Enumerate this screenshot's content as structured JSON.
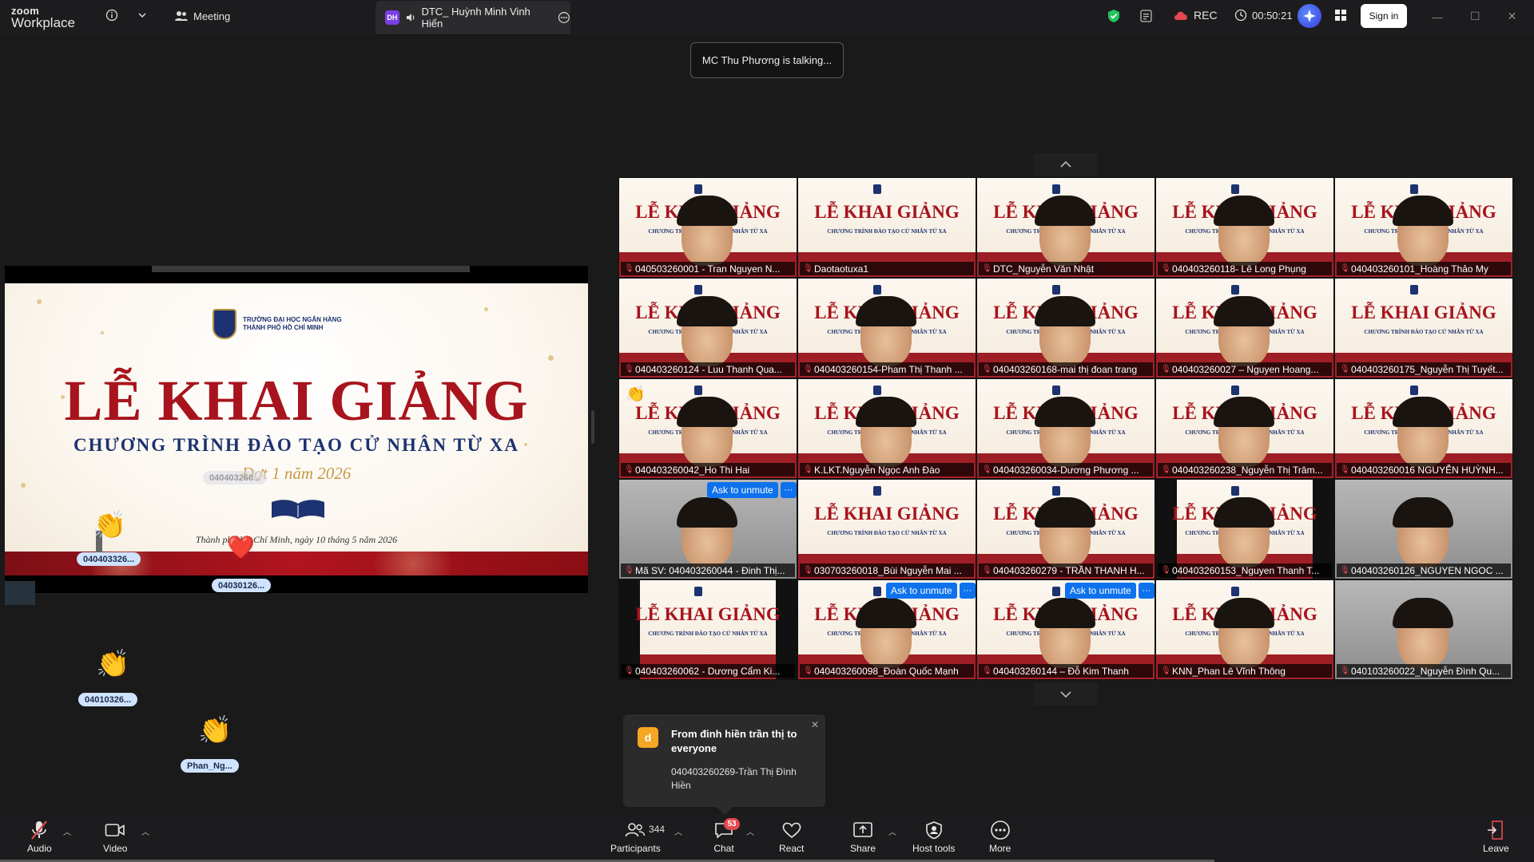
{
  "app": {
    "logo_line1": "zoom",
    "logo_line2": "Workplace"
  },
  "topbar": {
    "meeting_label": "Meeting",
    "share_tab_badge": "DH",
    "share_tab_label": "DTC_ Huỳnh Minh Vinh Hiển",
    "rec_label": "REC",
    "timer": "00:50:21",
    "sign_in_label": "Sign in"
  },
  "talking_banner": "MC Thu Phương is talking...",
  "slide": {
    "school_line1": "TRƯỜNG ĐẠI HỌC NGÂN HÀNG",
    "school_line2": "THÀNH PHỐ HỒ CHÍ MINH",
    "title": "LỄ KHAI GIẢNG",
    "subtitle": "CHƯƠNG TRÌNH ĐÀO TẠO CỬ NHÂN TỪ XA",
    "batch": "Đợt 1 năm 2026",
    "date_line": "Thành phố Hồ Chí Minh, ngày 10 tháng 5 năm 2026",
    "overlay_label": "040403260..."
  },
  "reactions": [
    {
      "emoji": "👏",
      "label": "040403326..."
    },
    {
      "emoji": "❤️",
      "label": "04030126..."
    },
    {
      "emoji": "👏",
      "label": "04010326..."
    },
    {
      "emoji": "👏",
      "label": "Phan_Ng..."
    }
  ],
  "tile_slide": {
    "title": "LỄ KHAI GIẢNG",
    "sub": "CHƯƠNG TRÌNH ĐÀO TẠO CỬ NHÂN TỪ XA"
  },
  "unmute": {
    "label": "Ask to unmute",
    "more": "···"
  },
  "participants": [
    {
      "name": "040503260001 - Tran Nguyen N..."
    },
    {
      "name": "Daotaotuxa1"
    },
    {
      "name": "DTC_Nguyễn Văn Nhật"
    },
    {
      "name": "040403260118- Lê Long Phụng"
    },
    {
      "name": "040403260101_Hoàng Thảo My"
    },
    {
      "name": "040403260124 - Luu Thanh Qua..."
    },
    {
      "name": "040403260154-Pham Thị Thanh ..."
    },
    {
      "name": "040403260168-mai thị đoan trang"
    },
    {
      "name": "040403260027 – Nguyen Hoang..."
    },
    {
      "name": "040403260175_Nguyễn Thị Tuyết..."
    },
    {
      "name": "040403260042_Ho Thi Hai"
    },
    {
      "name": "K.LKT.Nguyễn Ngọc Anh Đào"
    },
    {
      "name": "040403260034-Dương Phương ..."
    },
    {
      "name": "040403260238_Nguyễn Thị Trâm..."
    },
    {
      "name": "040403260016 NGUYỄN HUỲNH..."
    },
    {
      "name": "Mã SV: 040403260044 - Đinh Thị..."
    },
    {
      "name": "030703260018_Bùi Nguyễn Mai ..."
    },
    {
      "name": "040403260279 - TRẦN THANH H..."
    },
    {
      "name": "040403260153_Nguyen Thanh T..."
    },
    {
      "name": "040403260126_NGUYEN NGOC ..."
    },
    {
      "name": "040403260062 - Dương Cẩm Ki..."
    },
    {
      "name": "040403260098_Đoàn Quốc Mạnh"
    },
    {
      "name": "040403260144 – Đỗ Kim Thanh"
    },
    {
      "name": "KNN_Phan Lê Vĩnh Thông"
    },
    {
      "name": "040103260022_Nguyễn Đình Qu..."
    }
  ],
  "chat_toast": {
    "avatar": "d",
    "from": "From đinh hiền trần thị to everyone",
    "message": "040403260269-Trần Thị Đình Hiền"
  },
  "toolbar": {
    "audio": "Audio",
    "video": "Video",
    "participants": "Participants",
    "participants_count": "344",
    "chat": "Chat",
    "chat_badge": "53",
    "react": "React",
    "share": "Share",
    "host_tools": "Host tools",
    "more": "More",
    "leave": "Leave"
  },
  "colors": {
    "accent": "#0e72ed",
    "alert": "#e5484d",
    "slide_red": "#a7141d",
    "slide_navy": "#1d3270"
  }
}
